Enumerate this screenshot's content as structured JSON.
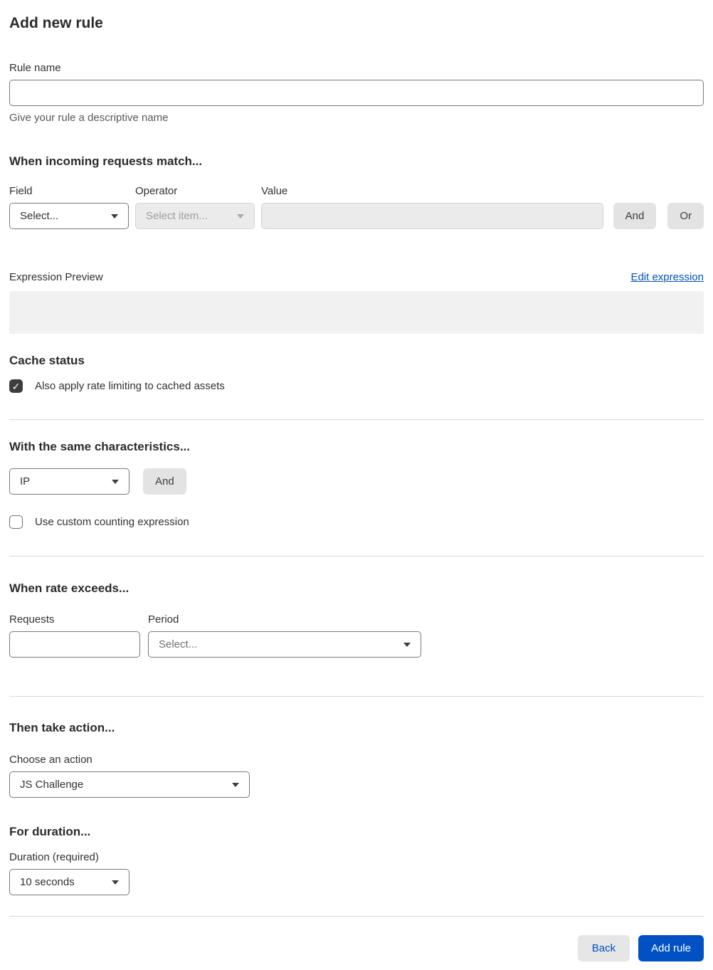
{
  "page": {
    "title": "Add new rule"
  },
  "rule_name": {
    "label": "Rule name",
    "value": "",
    "helper": "Give your rule a descriptive name"
  },
  "match": {
    "heading": "When incoming requests match...",
    "field": {
      "label": "Field",
      "selected": "Select..."
    },
    "operator": {
      "label": "Operator",
      "selected": "Select item...",
      "disabled": true
    },
    "value": {
      "label": "Value",
      "value": "",
      "disabled": true
    },
    "and_label": "And",
    "or_label": "Or"
  },
  "expression": {
    "label": "Expression Preview",
    "edit_link": "Edit expression",
    "content": ""
  },
  "cache": {
    "heading": "Cache status",
    "checkbox_label": "Also apply rate limiting to cached assets",
    "checked": true
  },
  "characteristics": {
    "heading": "With the same characteristics...",
    "selected": "IP",
    "and_label": "And",
    "checkbox_label": "Use custom counting expression",
    "checked": false
  },
  "rate": {
    "heading": "When rate exceeds...",
    "requests": {
      "label": "Requests",
      "value": ""
    },
    "period": {
      "label": "Period",
      "selected": "Select..."
    }
  },
  "action": {
    "heading": "Then take action...",
    "label": "Choose an action",
    "selected": "JS Challenge"
  },
  "duration": {
    "heading": "For duration...",
    "label": "Duration (required)",
    "selected": "10 seconds"
  },
  "footer": {
    "back_label": "Back",
    "add_label": "Add rule"
  },
  "colors": {
    "accent_blue": "#0051c3",
    "button_gray": "#e3e3e3",
    "checkbox_checked": "#3d3d3d",
    "preview_gray": "#f1f1f1",
    "divider": "#d9d9d9"
  }
}
